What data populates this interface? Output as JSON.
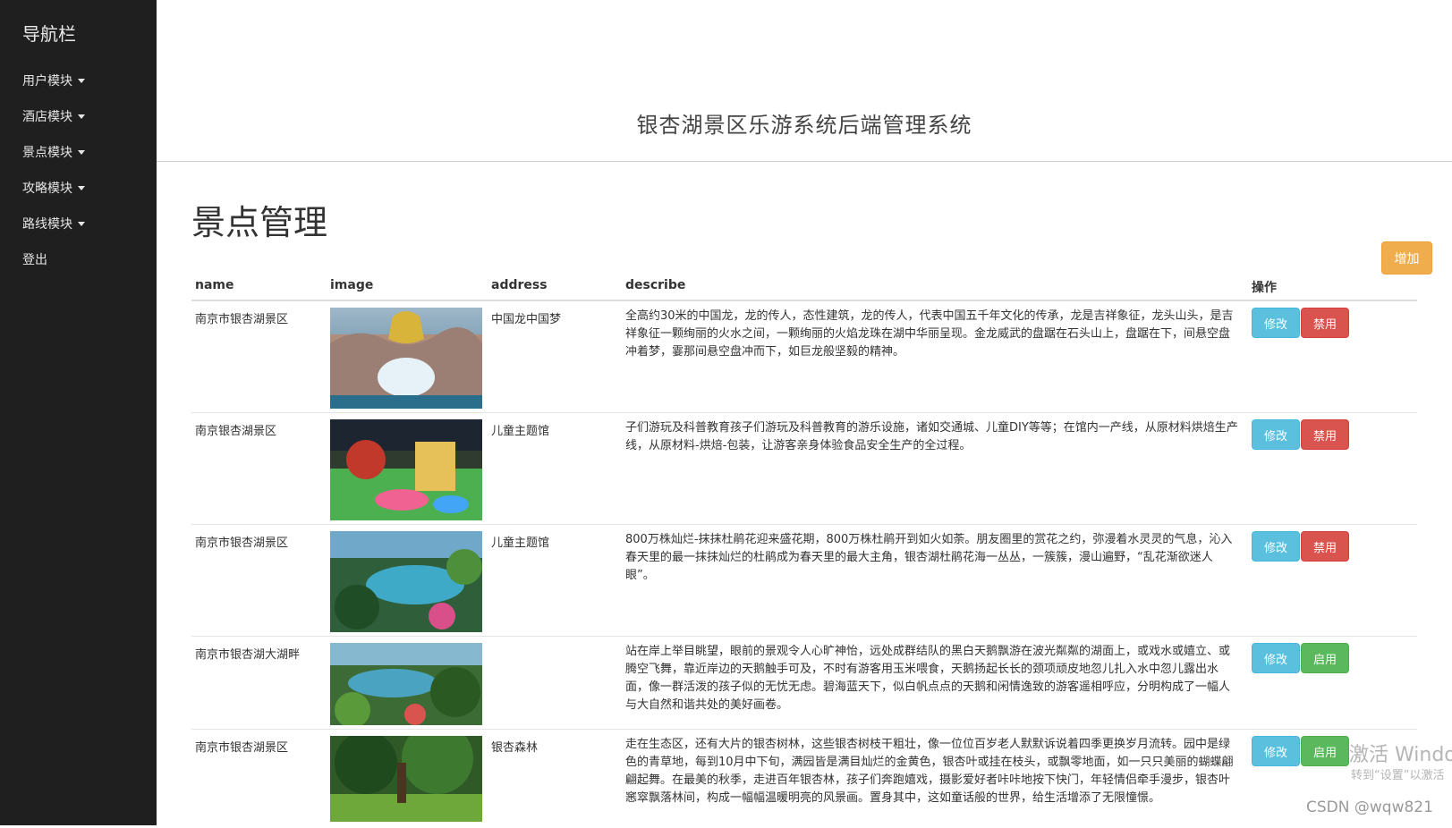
{
  "sidebar": {
    "brand": "导航栏",
    "items": [
      {
        "label": "用户模块",
        "has_caret": true
      },
      {
        "label": "酒店模块",
        "has_caret": true
      },
      {
        "label": "景点模块",
        "has_caret": true
      },
      {
        "label": "攻略模块",
        "has_caret": true
      },
      {
        "label": "路线模块",
        "has_caret": true
      },
      {
        "label": "登出",
        "has_caret": false
      }
    ]
  },
  "header": {
    "title": "银杏湖景区乐游系统后端管理系统"
  },
  "main": {
    "page_title": "景点管理",
    "add_button": "增加",
    "table": {
      "columns": [
        "name",
        "image",
        "address",
        "describe",
        "操作"
      ],
      "rows": [
        {
          "name": "南京市银杏湖景区",
          "address": "中国龙中国梦",
          "describe": "全高约30米的中国龙，龙的传人，态性建筑，龙的传人，代表中国五千年文化的传承，龙是吉祥象征，龙头山头，是吉祥象征一颗绚丽的火水之间，一颗绚丽的火焰龙珠在湖中华丽呈现。金龙威武的盘踞在石头山上，盘踞在下，间悬空盘冲着梦，霎那间悬空盘冲而下，如巨龙般坚毅的精神。",
          "image_icon": "dragon-fountain-image",
          "edit": "修改",
          "toggle": "禁用",
          "toggle_state": "disable"
        },
        {
          "name": "南京银杏湖景区",
          "address": "儿童主题馆",
          "describe": "子们游玩及科普教育孩子们游玩及科普教育的游乐设施，诸如交通城、儿童DIY等等；在馆内一产线，从原材料烘焙生产线，从原材料-烘焙-包装，让游客亲身体验食品安全生产的全过程。",
          "image_icon": "kids-playground-image",
          "edit": "修改",
          "toggle": "禁用",
          "toggle_state": "disable"
        },
        {
          "name": "南京市银杏湖景区",
          "address": "儿童主题馆",
          "describe": "800万株灿烂-抹抹杜鹃花迎来盛花期，800万株杜鹃开到如火如荼。朋友圈里的赏花之约，弥漫着水灵灵的气息，沁入春天里的最一抹抹灿烂的杜鹃成为春天里的最大主角，银杏湖杜鹃花海一丛丛，一簇簇，漫山遍野，“乱花渐欲迷人眼”。",
          "image_icon": "lake-garden-image",
          "edit": "修改",
          "toggle": "禁用",
          "toggle_state": "disable"
        },
        {
          "name": "南京市银杏湖大湖畔",
          "address": "",
          "describe": "站在岸上举目眺望，眼前的景观令人心旷神怡，远处成群结队的黑白天鹅飘游在波光粼粼的湖面上，或戏水或嬉立、或腾空飞舞，靠近岸边的天鹅触手可及，不时有游客用玉米喂食，天鹅扬起长长的颈项顽皮地忽儿扎入水中忽儿露出水面，像一群活泼的孩子似的无忧无虑。碧海蓝天下，似白帆点点的天鹅和闲情逸致的游客遥相呼应，分明构成了一幅人与大自然和谐共处的美好画卷。",
          "image_icon": "lakeside-forest-image",
          "edit": "修改",
          "toggle": "启用",
          "toggle_state": "enable"
        },
        {
          "name": "南京市银杏湖景区",
          "address": "银杏森林",
          "describe": "走在生态区，还有大片的银杏树林，这些银杏树枝干粗壮，像一位位百岁老人默默诉说着四季更换岁月流转。园中是绿色的青草地，每到10月中下旬，满园皆是满目灿烂的金黄色，银杏叶或挂在枝头，或飘零地面，如一只只美丽的蝴蝶翩翩起舞。在最美的秋季，走进百年银杏林，孩子们奔跑嬉戏，摄影爱好者咔咔地按下快门，年轻情侣牵手漫步，银杏叶窸窣飘落林间，构成一幅幅温暖明亮的风景画。置身其中，这如童话般的世界，给生活增添了无限憧憬。",
          "image_icon": "ginkgo-forest-image",
          "edit": "修改",
          "toggle": "启用",
          "toggle_state": "enable"
        }
      ]
    }
  },
  "overlay": {
    "activate_windows": "激活 Windows",
    "activate_hint": "转到“设置”以激活",
    "csdn_watermark": "CSDN @wqw821"
  },
  "colors": {
    "sidebar_bg": "#1f1f1f",
    "add_button": "#f0ad4e",
    "edit_button": "#5bc0de",
    "disable_button": "#d9534f",
    "enable_button": "#5cb85c"
  }
}
